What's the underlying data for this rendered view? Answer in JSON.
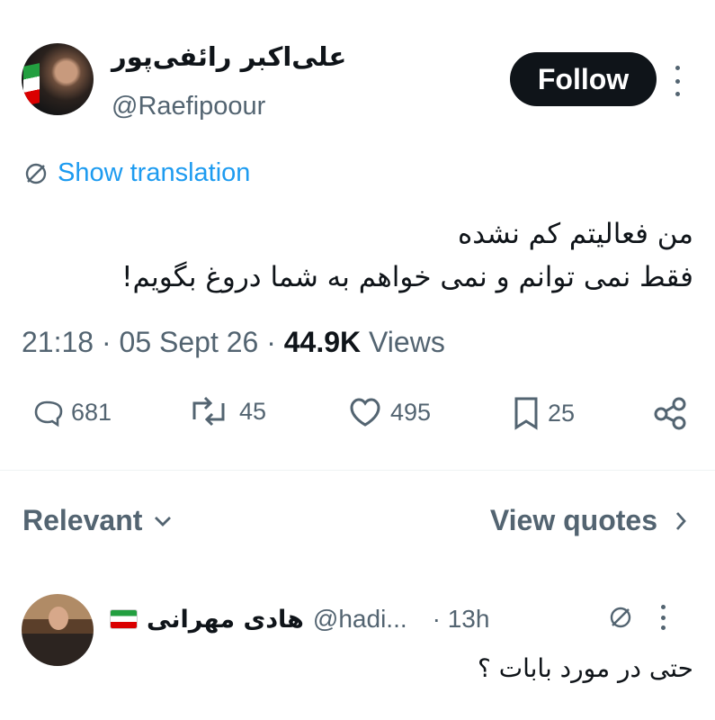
{
  "tweet": {
    "author_name": "علی‌اکبر رائفی‌پور",
    "author_handle": "@Raefipoour",
    "follow_label": "Follow",
    "translation_label": "Show translation",
    "text_line1": "من فعالیتم کم نشده",
    "text_line2": "فقط نمی توانم و نمی خواهم به شما دروغ بگویم!",
    "time": "21:18",
    "date": "05 Sept 26",
    "views_count": "44.9K",
    "views_label": "Views",
    "actions": {
      "replies": "681",
      "reposts": "45",
      "likes": "495",
      "bookmarks": "25"
    }
  },
  "filters": {
    "relevant_label": "Relevant",
    "view_quotes_label": "View quotes"
  },
  "reply": {
    "name": "هادی مهرانی",
    "handle": "@hadi...",
    "time": "· 13h",
    "text": "حتی در مورد بابات ؟"
  },
  "icons": [
    "grok-icon",
    "more-icon",
    "reply-icon",
    "repost-icon",
    "like-icon",
    "bookmark-icon",
    "share-icon",
    "chevron-down-icon",
    "chevron-right-icon",
    "iran-flag-icon"
  ],
  "colors": {
    "text": "#0f1419",
    "secondary": "#536471",
    "link": "#1d9bf0",
    "button": "#0f1419"
  }
}
